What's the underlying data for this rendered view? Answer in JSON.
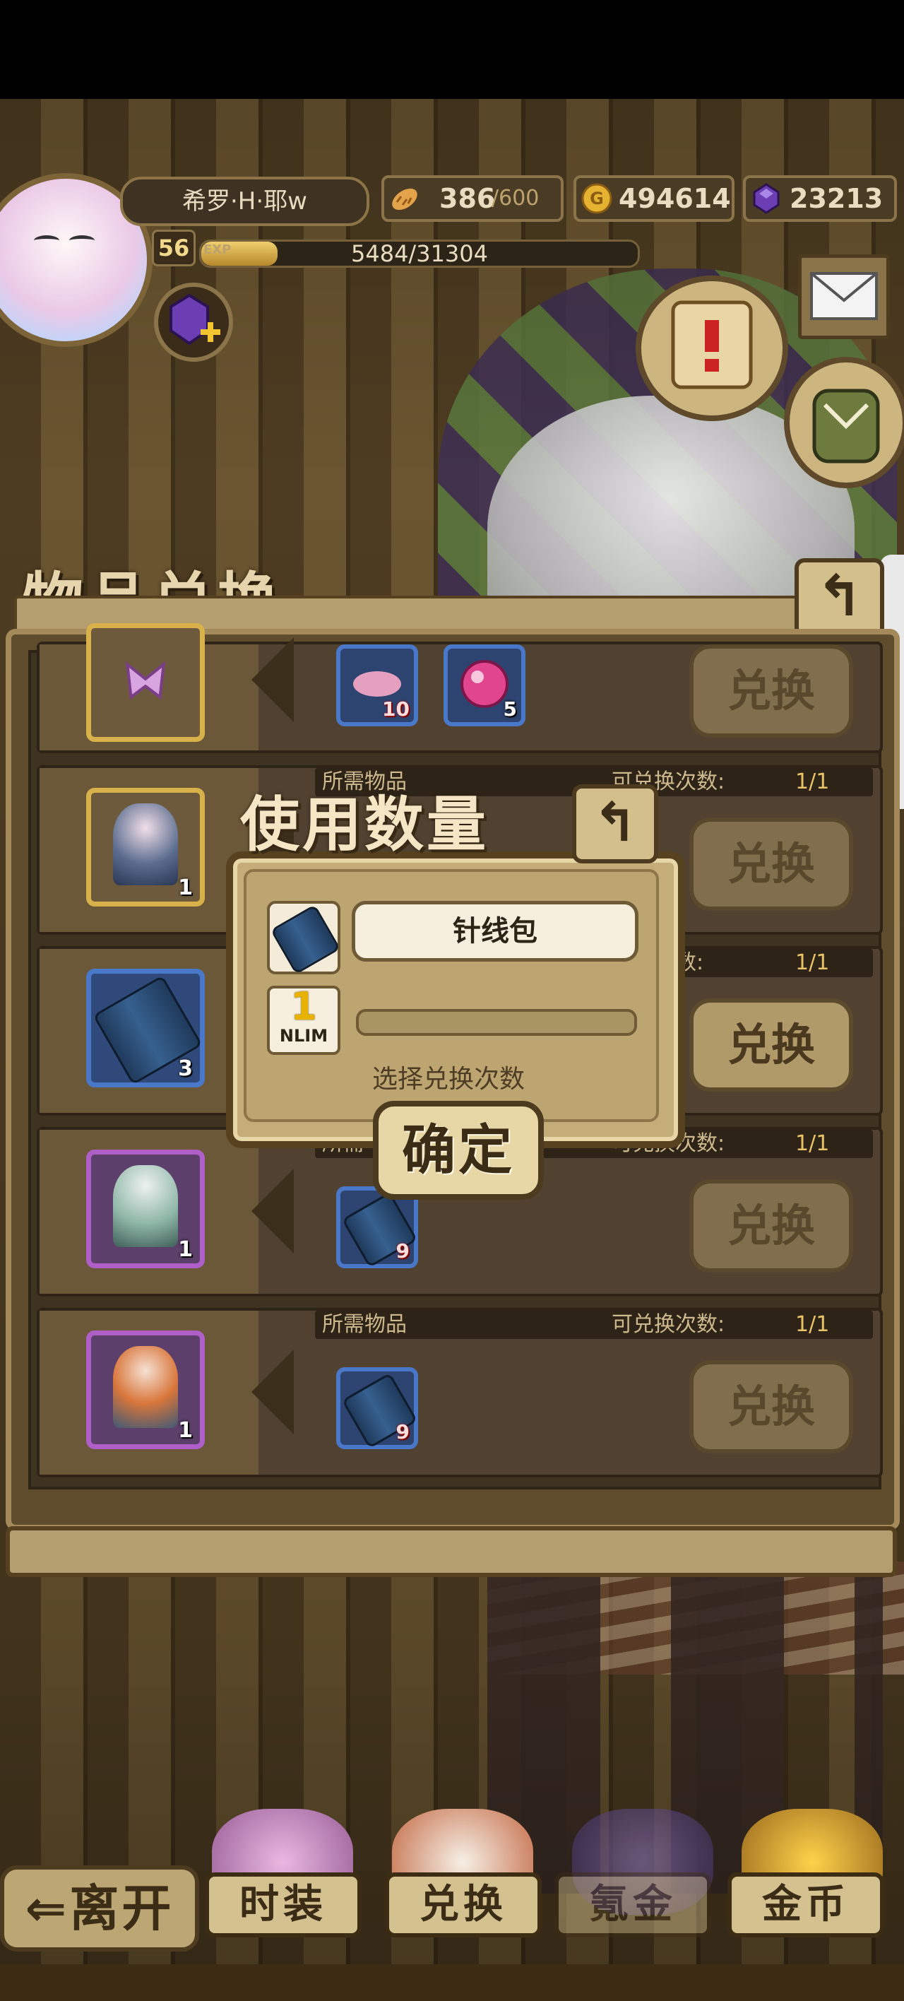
{
  "player": {
    "name": "希罗·H·耶w",
    "level": "56",
    "exp_label": "EXP",
    "exp_text": "5484/31304",
    "exp_fraction": 0.175
  },
  "resources": {
    "stamina_value": "386",
    "stamina_max": "/600",
    "gold": "494614",
    "gems": "23213"
  },
  "panel": {
    "title": "物品兑换",
    "back_icon": "back-arrow-icon"
  },
  "rows": [
    {
      "req_label": "",
      "times_label": "",
      "times_value": "",
      "item_count": "",
      "button": "兑换",
      "req": [
        {
          "count": "10"
        },
        {
          "count": "5"
        }
      ]
    },
    {
      "req_label": "所需物品",
      "times_label": "可兑换次数:",
      "times_value": "1/1",
      "item_count": "1",
      "button": "兑换"
    },
    {
      "req_label": "",
      "times_label": "换次数:",
      "times_value": "1/1",
      "item_count": "3",
      "button": "兑换"
    },
    {
      "req_label": "所需",
      "times_label": "可兑换次数:",
      "times_value": "1/1",
      "item_count": "1",
      "button": "兑换",
      "req": [
        {
          "count": "9"
        }
      ]
    },
    {
      "req_label": "所需物品",
      "times_label": "可兑换次数:",
      "times_value": "1/1",
      "item_count": "1",
      "button": "兑换",
      "req": [
        {
          "count": "9"
        }
      ]
    }
  ],
  "dialog": {
    "title": "使用数量",
    "item_name": "针线包",
    "quantity": "1",
    "quantity_unit": "NLIM",
    "slider_fraction": 0,
    "hint": "选择兑换次数",
    "confirm": "确定"
  },
  "nav": {
    "leave": "离开",
    "tabs": [
      "时装",
      "兑换",
      "氪金",
      "金币"
    ]
  },
  "colors": {
    "gold_border": "#d8b14b",
    "blue_border": "#4a78c9",
    "purple_border": "#b05fc8",
    "accent_yellow": "#e8c467"
  }
}
